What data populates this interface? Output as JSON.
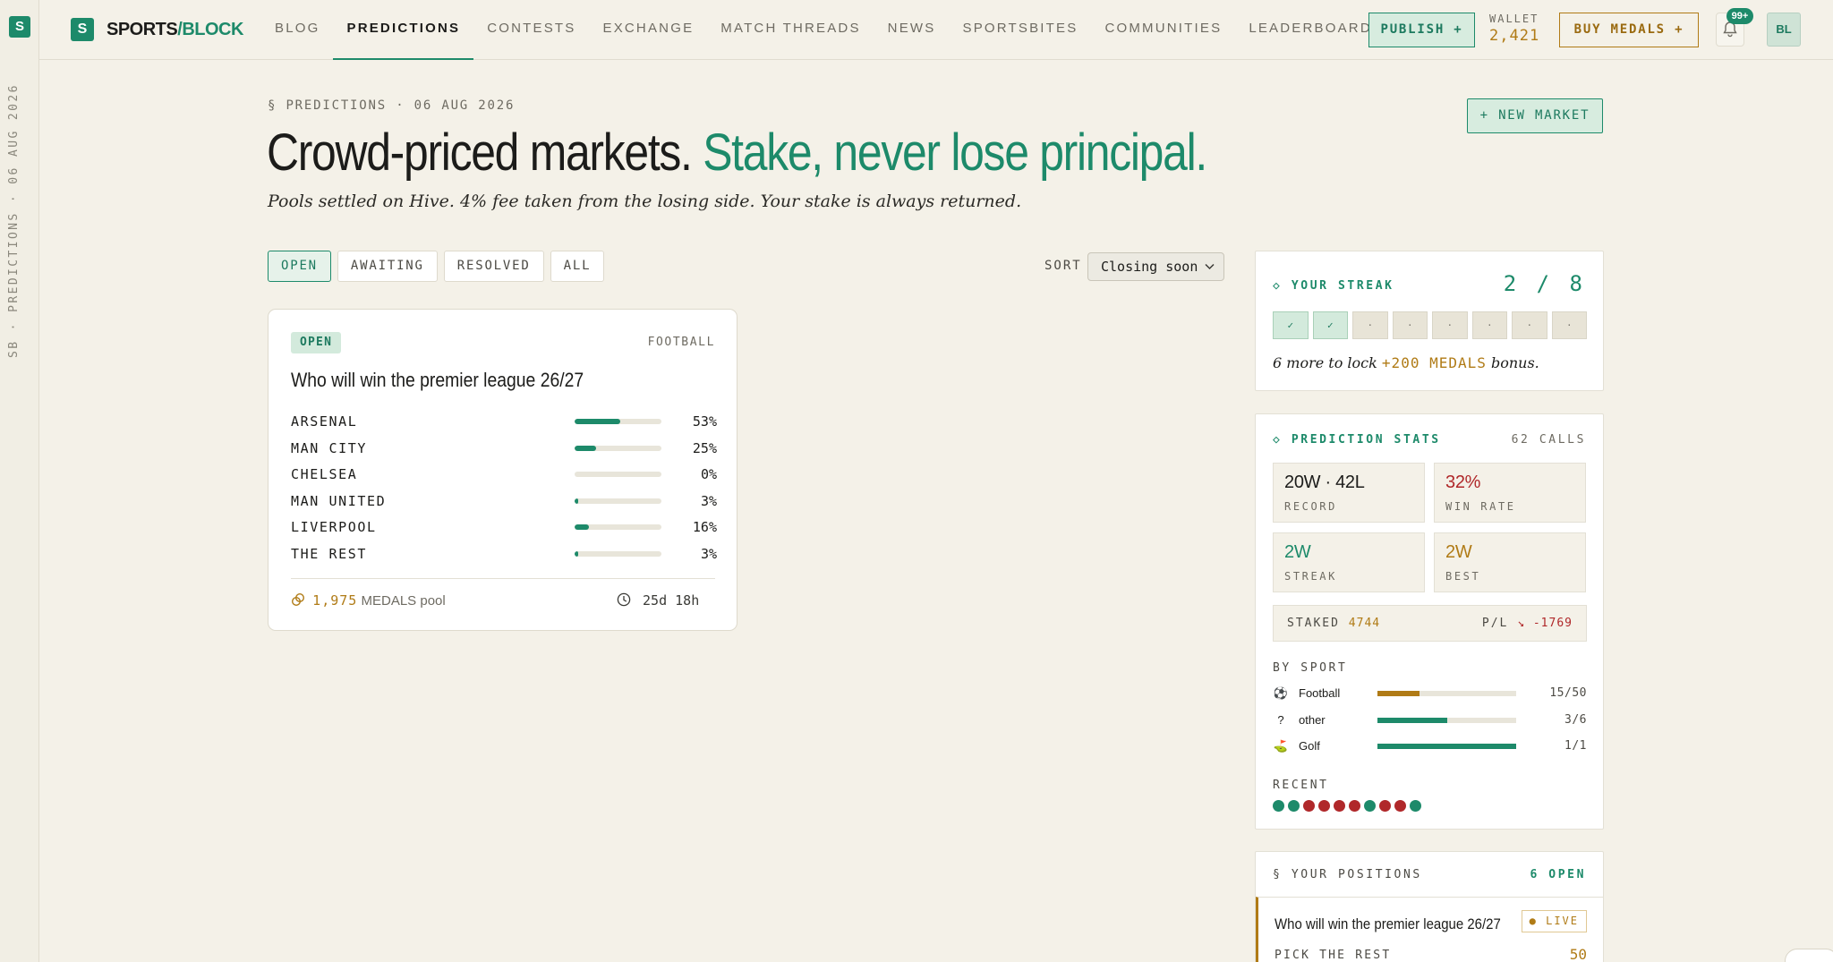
{
  "rail": {
    "logo": "S",
    "text": "SB · PREDICTIONS · 06 AUG 2026"
  },
  "brand": {
    "logo": "S",
    "name": "SPORTS",
    "slash": "/",
    "accent": "BLOCK"
  },
  "nav": [
    "BLOG",
    "PREDICTIONS",
    "CONTESTS",
    "EXCHANGE",
    "MATCH THREADS",
    "NEWS",
    "SPORTSBITES",
    "COMMUNITIES",
    "LEADERBOARD"
  ],
  "nav_active": "PREDICTIONS",
  "topbar": {
    "publish": "PUBLISH +",
    "wallet_label": "WALLET",
    "wallet_value": "2,421",
    "buy_medals": "BUY MEDALS +",
    "bell_icon": "bell-icon",
    "notif_badge": "99+",
    "avatar": "BL"
  },
  "header": {
    "eyebrow": "§ PREDICTIONS · 06 AUG 2026",
    "title_a": "Crowd-priced markets.",
    "title_b": "Stake, never lose principal.",
    "subtitle": "Pools settled on Hive. 4% fee taken from the losing side. Your stake is always returned.",
    "new_market": "+ NEW MARKET"
  },
  "filters": [
    "OPEN",
    "AWAITING",
    "RESOLVED",
    "ALL"
  ],
  "filter_active": "OPEN",
  "sort": {
    "label": "SORT",
    "value": "Closing soon"
  },
  "market": {
    "status": "OPEN",
    "sport": "FOOTBALL",
    "title": "Who will win the premier league 26/27",
    "outcomes": [
      {
        "name": "ARSENAL",
        "pct": 53,
        "label": "53%"
      },
      {
        "name": "MAN CITY",
        "pct": 25,
        "label": "25%"
      },
      {
        "name": "CHELSEA",
        "pct": 0,
        "label": "0%"
      },
      {
        "name": "MAN UNITED",
        "pct": 3,
        "label": "3%"
      },
      {
        "name": "LIVERPOOL",
        "pct": 16,
        "label": "16%"
      },
      {
        "name": "THE REST",
        "pct": 3,
        "label": "3%"
      }
    ],
    "pool_value": "1,975",
    "pool_unit": "MEDALS pool",
    "time_left": "25d 18h",
    "pool_icon": "coins-icon",
    "clock_icon": "clock-icon"
  },
  "streak": {
    "heading": "◇ YOUR STREAK",
    "value": "2 / 8",
    "boxes": [
      "✓",
      "✓",
      "·",
      "·",
      "·",
      "·",
      "·",
      "·"
    ],
    "on_count": 2,
    "note_a": "6 more to lock ",
    "note_bonus": "+200 MEDALS",
    "note_b": " bonus."
  },
  "stats": {
    "heading": "◇ PREDICTION STATS",
    "calls": "62 CALLS",
    "tiles": [
      {
        "value": "20W · 42L",
        "label": "RECORD",
        "color": "#1c1c1a"
      },
      {
        "value": "32%",
        "label": "WIN RATE",
        "color": "#b0282a"
      },
      {
        "value": "2W",
        "label": "STREAK",
        "color": "#1d8a6a"
      },
      {
        "value": "2W",
        "label": "BEST",
        "color": "#b07b16"
      }
    ],
    "staked_label": "STAKED",
    "staked_value": "4744",
    "pl_label": "P/L",
    "pl_value": "↘ -1769",
    "by_sport_label": "BY SPORT",
    "sports": [
      {
        "icon": "⚽",
        "name": "Football",
        "ratio": 0.3,
        "value": "15/50",
        "color": "#b07b16"
      },
      {
        "icon": "?",
        "name": "other",
        "ratio": 0.5,
        "value": "3/6",
        "color": "#1d8a6a"
      },
      {
        "icon": "⛳",
        "name": "Golf",
        "ratio": 1.0,
        "value": "1/1",
        "color": "#1d8a6a"
      }
    ],
    "recent_label": "RECENT",
    "recent": [
      "win",
      "win",
      "loss",
      "loss",
      "loss",
      "loss",
      "win",
      "loss",
      "loss",
      "win"
    ]
  },
  "positions": {
    "heading": "§ YOUR POSITIONS",
    "count": "6 OPEN",
    "item_title": "Who will win the premier league 26/27",
    "item_status": "● LIVE",
    "item_pick": "PICK THE REST",
    "item_value": "50"
  },
  "colors": {
    "accent": "#1d8a6a",
    "gold": "#b07b16",
    "loss": "#b0282a",
    "win": "#1d8a6a"
  }
}
